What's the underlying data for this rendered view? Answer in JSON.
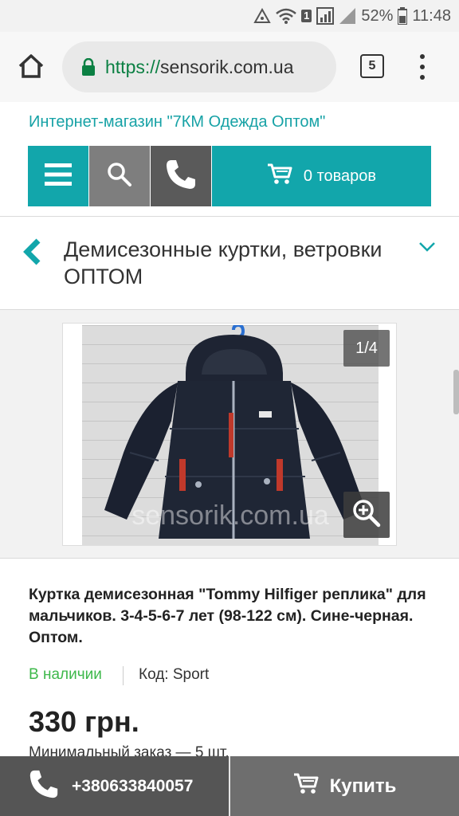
{
  "status_bar": {
    "battery": "52%",
    "time": "11:48",
    "sim_badge": "1",
    "icons": [
      "data-saver-icon",
      "wifi-icon",
      "signal-icon",
      "signal-empty-icon",
      "battery-icon"
    ]
  },
  "browser": {
    "url_scheme": "https://",
    "url_host": "sensorik.com.ua",
    "tab_count": "5",
    "icons": [
      "home-icon",
      "lock-icon",
      "more-vert-icon"
    ]
  },
  "site": {
    "title": "Интернет-магазин \"7КМ Одежда Оптом\"",
    "cart_label": "0 товаров",
    "icons": [
      "menu-icon",
      "search-icon",
      "phone-icon",
      "cart-icon"
    ]
  },
  "category": {
    "title": "Демисезонные куртки, ветровки ОПТОМ",
    "icons": [
      "chevron-left-icon",
      "chevron-down-icon"
    ]
  },
  "gallery": {
    "counter": "1/4",
    "watermark": "sensorik.com.ua",
    "icons": [
      "zoom-in-icon"
    ]
  },
  "product": {
    "name": "Куртка демисезонная \"Tommy Hilfiger реплика\" для мальчиков. 3-4-5-6-7 лет (98-122 см). Сине-черная. Оптом.",
    "availability": "В наличии",
    "code": "Код: Sport",
    "price": "330 грн.",
    "min_order": "Минимальный заказ — 5 шт."
  },
  "bottom_bar": {
    "phone": "+380633840057",
    "buy_label": "Купить",
    "icons": [
      "phone-icon",
      "cart-icon"
    ]
  },
  "colors": {
    "accent": "#12a6ab",
    "in_stock": "#3db84a",
    "url_green": "#0b8043"
  }
}
